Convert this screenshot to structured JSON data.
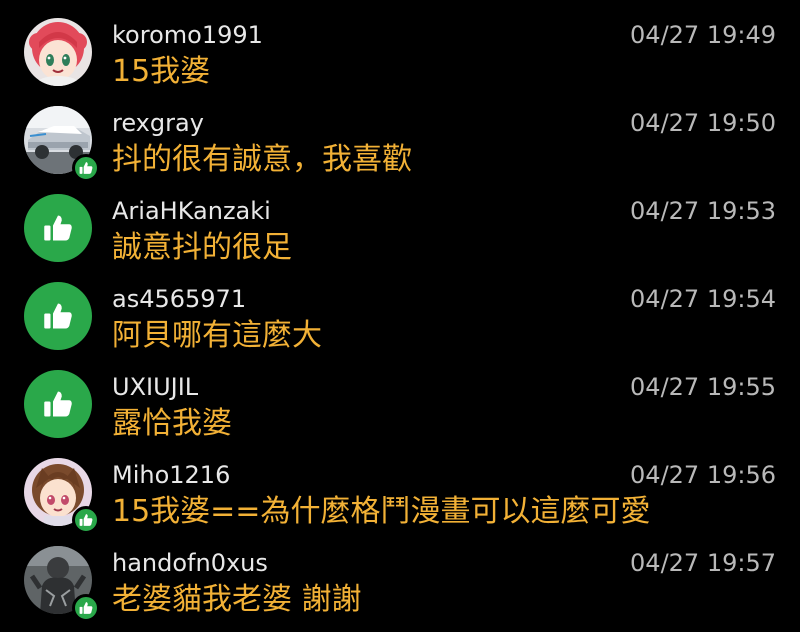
{
  "comments": [
    {
      "username": "koromo1991",
      "time": "04/27 19:49",
      "text": "15我婆",
      "avatar": "anime-girl-pink-hair-avatar",
      "liked": false
    },
    {
      "username": "rexgray",
      "time": "04/27 19:50",
      "text": "抖的很有誠意，我喜歡",
      "avatar": "car-photo-avatar",
      "liked": true
    },
    {
      "username": "AriaHKanzaki",
      "time": "04/27 19:53",
      "text": "誠意抖的很足",
      "avatar": "thumbs-up-icon",
      "liked": true
    },
    {
      "username": "as4565971",
      "time": "04/27 19:54",
      "text": "阿貝哪有這麼大",
      "avatar": "thumbs-up-icon",
      "liked": true
    },
    {
      "username": "UXIUJIL",
      "time": "04/27 19:55",
      "text": "露恰我婆",
      "avatar": "thumbs-up-icon",
      "liked": true
    },
    {
      "username": "Miho1216",
      "time": "04/27 19:56",
      "text": "15我婆==為什麼格鬥漫畫可以這麼可愛",
      "avatar": "anime-girl-brown-hair-avatar",
      "liked": true
    },
    {
      "username": "handofn0xus",
      "time": "04/27 19:57",
      "text": "老婆貓我老婆 謝謝",
      "avatar": "statue-photo-avatar",
      "liked": true
    }
  ],
  "colors": {
    "background": "#000000",
    "username": "#e8e8e8",
    "timestamp": "#b9b9b9",
    "message": "#f2b136",
    "like": "#2aa84a"
  }
}
